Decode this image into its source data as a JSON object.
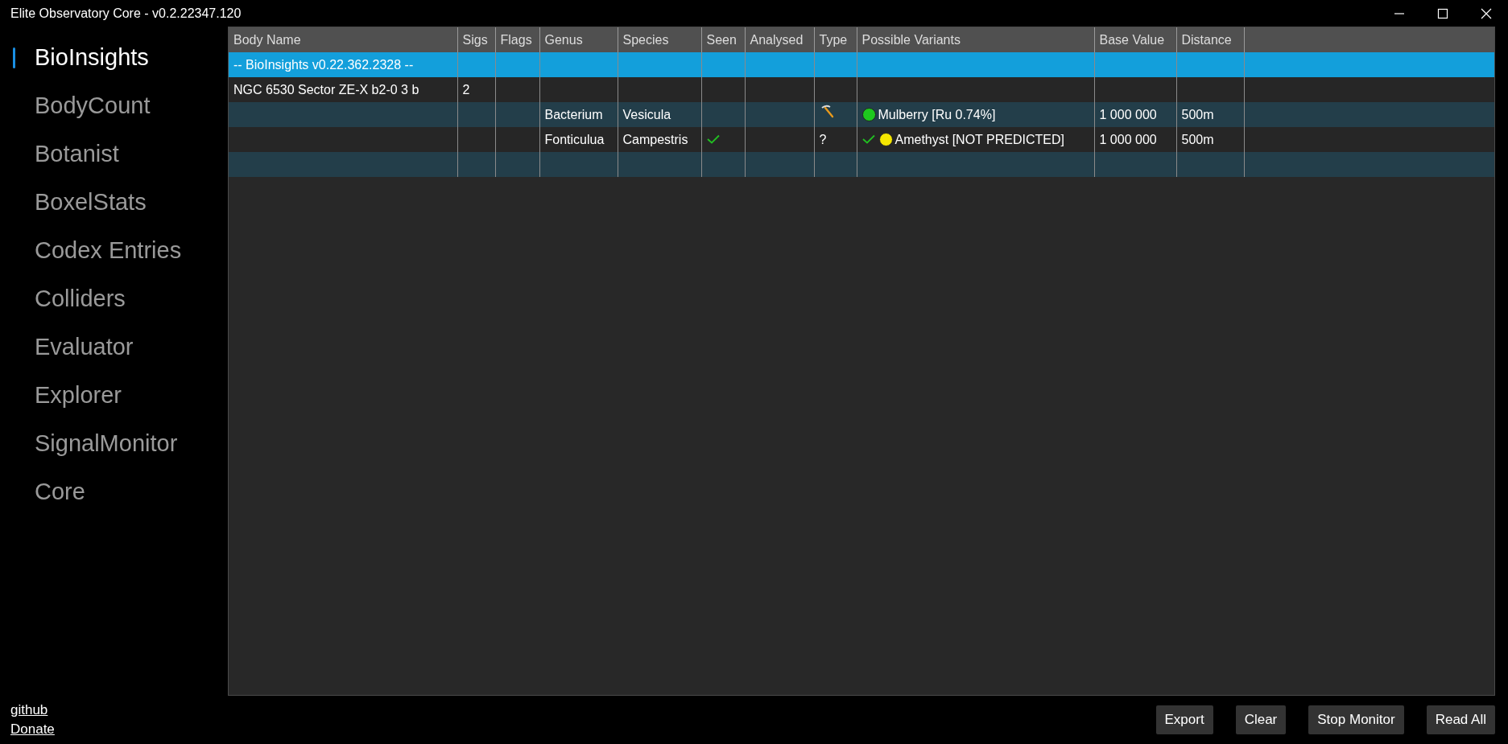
{
  "window": {
    "title": "Elite Observatory Core - v0.2.22347.120"
  },
  "sidebar": {
    "items": [
      {
        "label": "BioInsights",
        "selected": true
      },
      {
        "label": "BodyCount",
        "selected": false
      },
      {
        "label": "Botanist",
        "selected": false
      },
      {
        "label": "BoxelStats",
        "selected": false
      },
      {
        "label": "Codex Entries",
        "selected": false
      },
      {
        "label": "Colliders",
        "selected": false
      },
      {
        "label": "Evaluator",
        "selected": false
      },
      {
        "label": "Explorer",
        "selected": false
      },
      {
        "label": "SignalMonitor",
        "selected": false
      },
      {
        "label": "Core",
        "selected": false
      }
    ]
  },
  "table": {
    "columns": [
      "Body Name",
      "Sigs",
      "Flags",
      "Genus",
      "Species",
      "Seen",
      "Analysed",
      "Type",
      "Possible Variants",
      "Base Value",
      "Distance"
    ],
    "rows": [
      {
        "selected": true,
        "body_name": "-- BioInsights v0.22.362.2328  --"
      },
      {
        "selected": false,
        "body_name": "NGC 6530 Sector ZE-X b2-0 3 b",
        "sigs": "2"
      },
      {
        "selected": false,
        "genus": "Bacterium",
        "species": "Vesicula",
        "seen": false,
        "pickaxe": true,
        "variant": {
          "seen": false,
          "color": "#1ec81e",
          "text": "Mulberry [Ru 0.74%]"
        },
        "base_value": "1 000 000",
        "distance": "500m"
      },
      {
        "selected": false,
        "genus": "Fonticulua",
        "species": "Campestris",
        "seen": true,
        "pickaxe": false,
        "type": "?",
        "variant": {
          "seen": true,
          "color": "#f5e600",
          "text": "Amethyst [NOT PREDICTED]"
        },
        "base_value": "1 000 000",
        "distance": "500m"
      },
      {
        "selected": false
      }
    ]
  },
  "links": [
    "github",
    "Donate"
  ],
  "buttons": [
    "Export",
    "Clear",
    "Stop Monitor",
    "Read All"
  ]
}
